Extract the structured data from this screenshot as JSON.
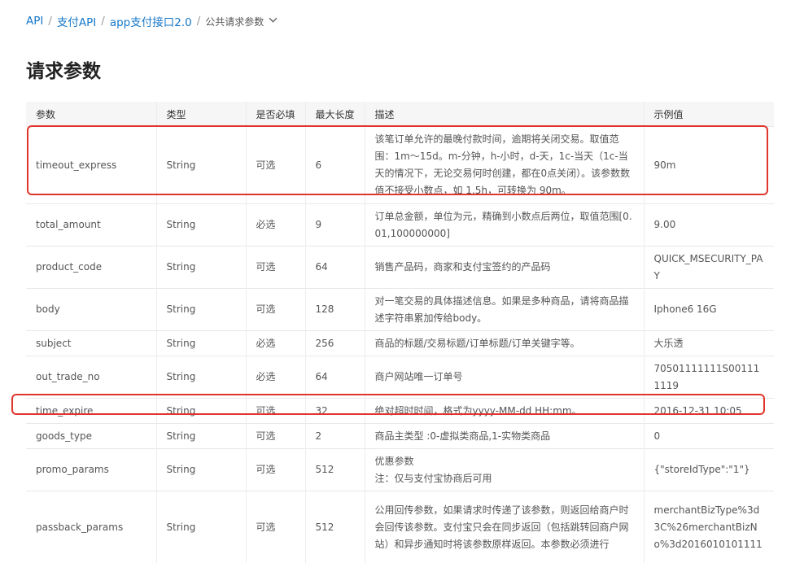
{
  "breadcrumb": {
    "items": [
      "API",
      "支付API",
      "app支付接口2.0"
    ],
    "current": "公共请求参数",
    "separator": "/"
  },
  "title": "请求参数",
  "table": {
    "headers": [
      "参数",
      "类型",
      "是否必填",
      "最大长度",
      "描述",
      "示例值"
    ],
    "rows": [
      [
        "timeout_express",
        "String",
        "可选",
        "6",
        "该笔订单允许的最晚付款时间，逾期将关闭交易。取值范围：1m～15d。m-分钟，h-小时，d-天，1c-当天（1c-当天的情况下，无论交易何时创建，都在0点关闭）。该参数数值不接受小数点，如 1.5h，可转换为 90m。",
        "90m"
      ],
      [
        "total_amount",
        "String",
        "必选",
        "9",
        "订单总金额，单位为元，精确到小数点后两位，取值范围[0.01,100000000]",
        "9.00"
      ],
      [
        "product_code",
        "String",
        "可选",
        "64",
        "销售产品码，商家和支付宝签约的产品码",
        "QUICK_MSECURITY_PAY"
      ],
      [
        "body",
        "String",
        "可选",
        "128",
        "对一笔交易的具体描述信息。如果是多种商品，请将商品描述字符串累加传给body。",
        "Iphone6 16G"
      ],
      [
        "subject",
        "String",
        "必选",
        "256",
        "商品的标题/交易标题/订单标题/订单关键字等。",
        "大乐透"
      ],
      [
        "out_trade_no",
        "String",
        "必选",
        "64",
        "商户网站唯一订单号",
        "70501111111S001111119"
      ],
      [
        "time_expire",
        "String",
        "可选",
        "32",
        "绝对超时时间，格式为yyyy-MM-dd HH:mm。",
        "2016-12-31 10:05"
      ],
      [
        "goods_type",
        "String",
        "可选",
        "2",
        "商品主类型 :0-虚拟类商品,1-实物类商品",
        "0"
      ],
      [
        "promo_params",
        "String",
        "可选",
        "512",
        "优惠参数\n注：仅与支付宝协商后可用",
        "{\"storeIdType\":\"1\"}"
      ],
      [
        "passback_params",
        "String",
        "可选",
        "512",
        "公用回传参数，如果请求时传递了该参数，则返回给商户时会回传该参数。支付宝只会在同步返回（包括跳转回商户网站）和异步通知时将该参数原样返回。本参数必须进行",
        "merchantBizType%3d3C%26merchantBizNo%3d2016010101111"
      ]
    ]
  },
  "colors": {
    "link": "#1677c8",
    "highlight": "#e0352b",
    "header_bg": "#f6f6f6"
  }
}
